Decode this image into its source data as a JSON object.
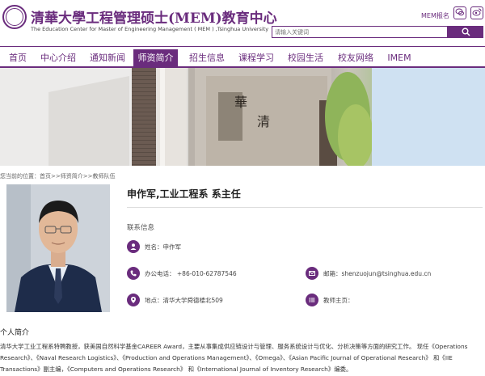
{
  "header": {
    "logo_cn": "清華大學工程管理硕士(MEM)教育中心",
    "logo_en": "The Education Center for Master of Engineering Management ( MEM ) ,Tsinghua University",
    "mem_signup": "MEM报名",
    "social_icons": [
      "wechat-icon",
      "weibo-icon"
    ],
    "search_placeholder": "请输入关键词",
    "accent_color": "#6a2c7d"
  },
  "nav": {
    "items": [
      "首页",
      "中心介绍",
      "通知新闻",
      "师资简介",
      "招生信息",
      "课程学习",
      "校园生活",
      "校友网络",
      "IMEM"
    ],
    "active": "师资简介"
  },
  "breadcrumb": "您当前的位置：首页>>师资简介>>教师队伍",
  "profile": {
    "title": "申作军,工业工程系 系主任",
    "contact_heading": "联系信息",
    "name": "姓名：申作军",
    "phone": "办公电话： +86-010-62787546",
    "email": "邮箱：shenzuojun@tsinghua.edu.cn",
    "address": "地点：清华大学舜德楼北509",
    "homepage": "教师主页："
  },
  "bio": {
    "heading": "个人简介",
    "lines": [
      "清华大学工业工程系特聘教授，获美国自然科学基金CAREER Award，主要从事集成供应链设计与管理、服务系统设计与优化、分析决策等方面的研究工作。 现任《Operations",
      "Research》、《Naval Research Logistics》、《Production and Operations Management》、《Omega》、《Asian Pacific Journal of Operational Research》 和《IIE",
      "Transactions》副主编，《Computers and Operations Research》 和《International Journal of Inventory Research》编委。"
    ]
  }
}
